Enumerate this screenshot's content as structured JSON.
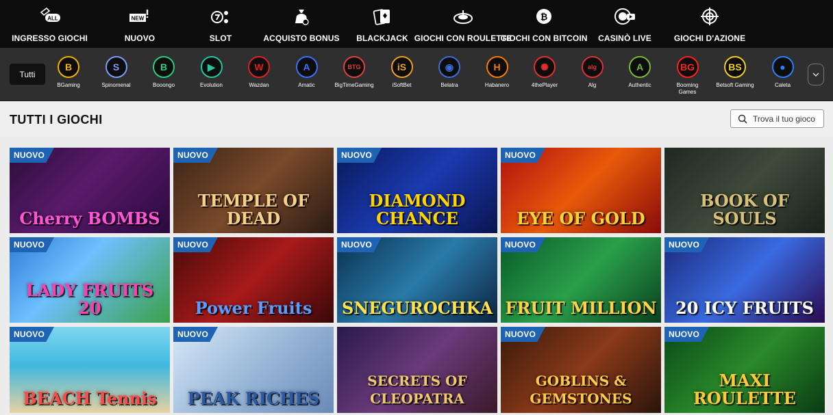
{
  "top_nav": [
    {
      "label": "INGRESSO GIOCHI",
      "icon": "all-games-icon"
    },
    {
      "label": "NUOVO",
      "icon": "new-icon"
    },
    {
      "label": "SLOT",
      "icon": "slot-icon"
    },
    {
      "label": "ACQUISTO BONUS",
      "icon": "money-bag-icon"
    },
    {
      "label": "BLACKJACK",
      "icon": "cards-icon"
    },
    {
      "label": "GIOCHI CON ROULETTE",
      "icon": "roulette-icon"
    },
    {
      "label": "GIOCHI CON BITCOIN",
      "icon": "bitcoin-icon"
    },
    {
      "label": "CASINÒ LIVE",
      "icon": "live-casino-icon"
    },
    {
      "label": "GIOCHI D'AZIONE",
      "icon": "crosshair-icon"
    }
  ],
  "nav_badge": {
    "all": "ALL",
    "new": "NEW"
  },
  "providers": {
    "all_label": "Tutti",
    "items": [
      {
        "name": "BGaming",
        "glyph": "B",
        "color": "#f0b400"
      },
      {
        "name": "Spinomenal",
        "glyph": "S",
        "color": "#7aa0ff"
      },
      {
        "name": "Booongo",
        "glyph": "B",
        "color": "#26d07c"
      },
      {
        "name": "Evolution",
        "glyph": "▶",
        "color": "#22c9a0"
      },
      {
        "name": "Wazdan",
        "glyph": "W",
        "color": "#e02020"
      },
      {
        "name": "Amatic",
        "glyph": "A",
        "color": "#3a70ff"
      },
      {
        "name": "BigTimeGaming",
        "glyph": "BTG",
        "color": "#e04040"
      },
      {
        "name": "iSoftBet",
        "glyph": "iS",
        "color": "#f0a020"
      },
      {
        "name": "Belatra",
        "glyph": "◉",
        "color": "#3a6fd8"
      },
      {
        "name": "Habanero",
        "glyph": "H",
        "color": "#ff7a00"
      },
      {
        "name": "4thePlayer",
        "glyph": "✺",
        "color": "#e03030"
      },
      {
        "name": "Alg",
        "glyph": "alg",
        "color": "#e03030"
      },
      {
        "name": "Authentic",
        "glyph": "A",
        "color": "#7ab83a"
      },
      {
        "name": "Booming Games",
        "glyph": "BG",
        "color": "#ff2020"
      },
      {
        "name": "Betsoft Gaming",
        "glyph": "BS",
        "color": "#f0d020"
      },
      {
        "name": "Caleta",
        "glyph": "●",
        "color": "#2a7fff"
      }
    ]
  },
  "section": {
    "title": "TUTTI I GIOCHI",
    "search_label": "Trova il tuo gioco"
  },
  "badge_label": "NUOVO",
  "games": [
    {
      "title": "Cherry BOMBS",
      "new": true,
      "bg": "linear-gradient(135deg,#2a0f3a 0%,#5a1a6a 45%,#2b0a40 100%)",
      "color": "#ff55d6"
    },
    {
      "title": "TEMPLE OF DEAD",
      "new": true,
      "bg": "linear-gradient(135deg,#3a2418 0%,#7a4a2a 50%,#2a1a14 100%)",
      "color": "#f5d28a"
    },
    {
      "title": "DIAMOND CHANCE",
      "new": true,
      "bg": "linear-gradient(135deg,#081a5a 0%,#1b3ab0 50%,#0a1450 100%)",
      "color": "#ffd400"
    },
    {
      "title": "EYE OF GOLD",
      "new": true,
      "bg": "linear-gradient(135deg,#b01010 0%,#e85a0a 50%,#8a0a0a 100%)",
      "color": "#ffd23a"
    },
    {
      "title": "BOOK OF SOULS",
      "new": false,
      "bg": "linear-gradient(135deg,#1e2a22 0%,#3e4a3a 50%,#1a221c 100%)",
      "color": "#d9c07a"
    },
    {
      "title": "LADY FRUITS 20",
      "new": true,
      "bg": "linear-gradient(135deg,#2c7bd6 0%,#6fc0ff 40%,#3aa04a 100%)",
      "color": "#ff3fb0"
    },
    {
      "title": "Power Fruits",
      "new": true,
      "bg": "linear-gradient(135deg,#4a0a0a 0%,#a81a1a 50%,#3a0808 100%)",
      "color": "#5a9cff"
    },
    {
      "title": "SNEGUROCHKA",
      "new": true,
      "bg": "linear-gradient(135deg,#0a3050 0%,#2a7aa8 50%,#0c2440 100%)",
      "color": "#ffe24a"
    },
    {
      "title": "FRUIT MILLION",
      "new": true,
      "bg": "linear-gradient(135deg,#0a5a2a 0%,#2aa04a 50%,#0a4020 100%)",
      "color": "#ffd24a"
    },
    {
      "title": "20 ICY FRUITS",
      "new": true,
      "bg": "linear-gradient(135deg,#1a2a7a 0%,#3a6ae0 50%,#2a0a50 100%)",
      "color": "#ffffff"
    },
    {
      "title": "BEACH Tennis",
      "new": true,
      "bg": "linear-gradient(180deg,#7fd6f0 0%,#3fb8e0 45%,#e8d2a0 100%)",
      "color": "#ff4a4a"
    },
    {
      "title": "PEAK RICHES",
      "new": true,
      "bg": "linear-gradient(135deg,#d8e8f8 0%,#9ab8d8 50%,#6a8ab8 100%)",
      "color": "#2a5aa8"
    },
    {
      "title": "SECRETS OF CLEOPATRA",
      "new": false,
      "bg": "linear-gradient(135deg,#2a1a4a 0%,#6a3a7a 50%,#3a1a2a 100%)",
      "color": "#f0c870"
    },
    {
      "title": "GOBLINS & GEMSTONES",
      "new": true,
      "bg": "linear-gradient(135deg,#3a1a0a 0%,#8a3a1a 50%,#2a140a 100%)",
      "color": "#ffcc4a"
    },
    {
      "title": "MAXI ROULETTE",
      "new": true,
      "bg": "linear-gradient(135deg,#0a4a1a 0%,#2a8a2a 50%,#0a3a14 100%)",
      "color": "#ffc83a"
    }
  ]
}
